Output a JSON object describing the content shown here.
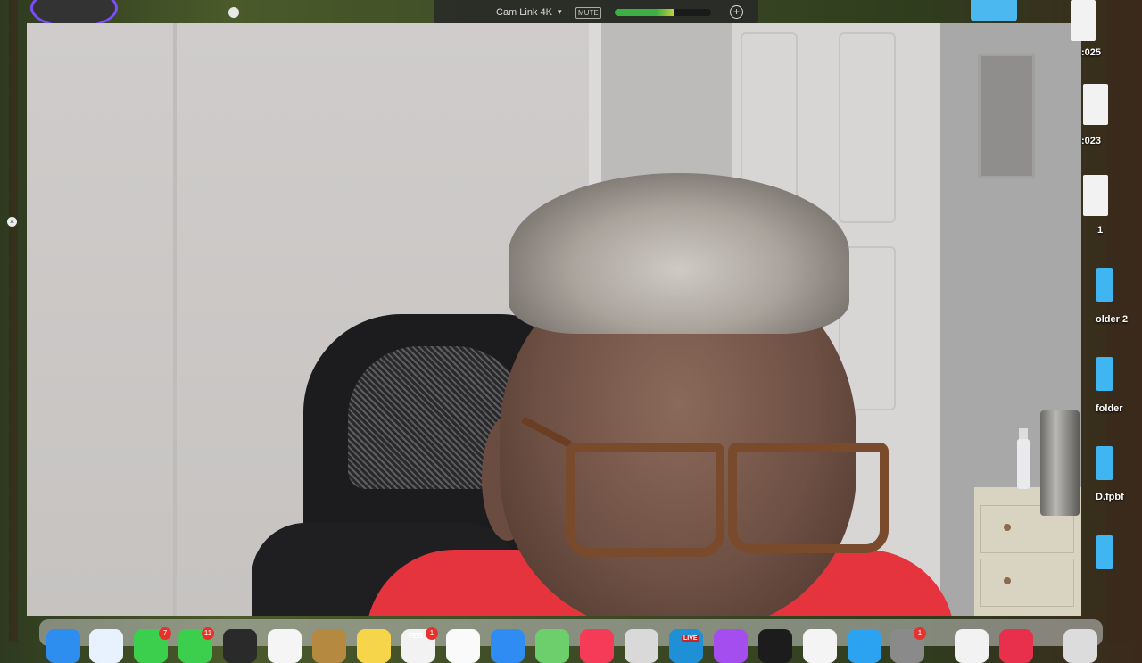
{
  "camera_bar": {
    "device_label": "Cam Link 4K",
    "mute_label": "MUTE",
    "audio_level": 0.62,
    "icons": {
      "caret": "chevron-down-icon",
      "add": "plus-circle-icon"
    }
  },
  "desktop_items": [
    {
      "label": ":025",
      "kind": "doc"
    },
    {
      "label": ":023",
      "kind": "doc"
    },
    {
      "label": "1",
      "kind": "doc"
    },
    {
      "label": "older 2",
      "kind": "folder"
    },
    {
      "label": "folder",
      "kind": "folder"
    },
    {
      "label": "D.fpbf",
      "kind": "folder"
    },
    {
      "label": "",
      "kind": "folder"
    }
  ],
  "dock": {
    "badges": {
      "facetime": "7",
      "messages": "11",
      "calendar": "1",
      "settings": "1"
    },
    "calendar_month": "FEB",
    "live_label": "LIVE"
  },
  "colors": {
    "accent_avatar_ring": "#7c4dff",
    "badge": "#e5322d",
    "shirt": "#e6343f"
  }
}
